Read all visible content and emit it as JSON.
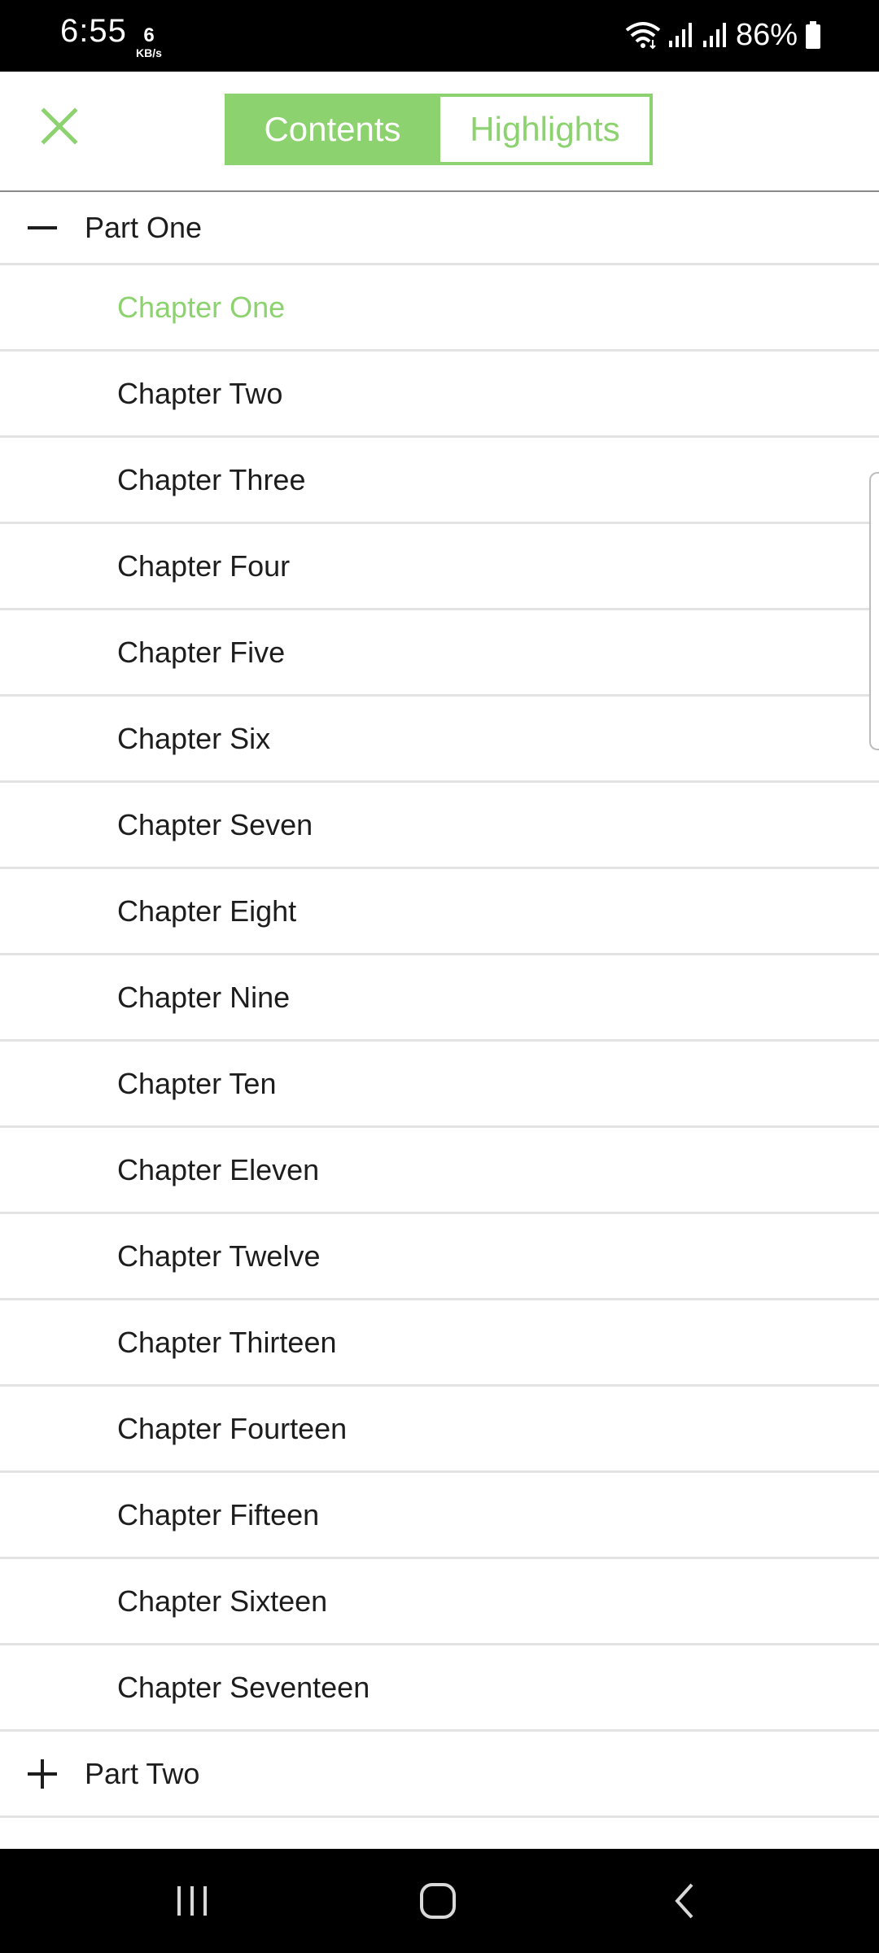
{
  "status": {
    "time": "6:55",
    "net_speed_value": "6",
    "net_speed_unit": "KB/s",
    "battery": "86%",
    "icons": [
      "wifi-icon",
      "signal-icon",
      "signal-icon",
      "battery-icon"
    ]
  },
  "header": {
    "close_icon": "close-icon",
    "tabs": [
      {
        "label": "Contents",
        "active": true
      },
      {
        "label": "Highlights",
        "active": false
      }
    ]
  },
  "toc": {
    "parts": [
      {
        "label": "Part One",
        "expanded": true,
        "toggle_icon": "minus-icon",
        "chapters": [
          "Chapter One",
          "Chapter Two",
          "Chapter Three",
          "Chapter Four",
          "Chapter Five",
          "Chapter Six",
          "Chapter Seven",
          "Chapter Eight",
          "Chapter Nine",
          "Chapter Ten",
          "Chapter Eleven",
          "Chapter Twelve",
          "Chapter Thirteen",
          "Chapter Fourteen",
          "Chapter Fifteen",
          "Chapter Sixteen",
          "Chapter Seventeen"
        ],
        "current_chapter": "Chapter One"
      },
      {
        "label": "Part Two",
        "expanded": false,
        "toggle_icon": "plus-icon"
      }
    ]
  },
  "colors": {
    "accent": "#8cd26e",
    "text": "#1d1d1d",
    "divider": "#e3e3e3"
  },
  "nav_bar": {
    "buttons": [
      "recent-apps-icon",
      "home-icon",
      "back-icon"
    ]
  }
}
